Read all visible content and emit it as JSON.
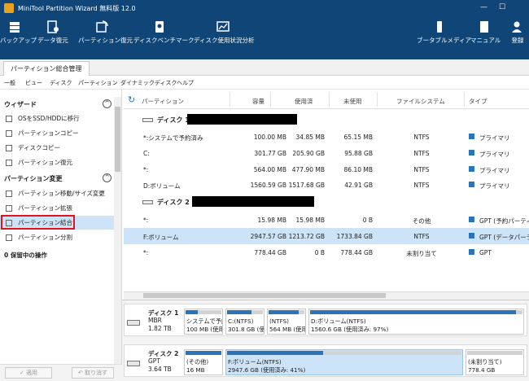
{
  "app": {
    "title": "MiniTool Partition Wizard 無料版 12.0"
  },
  "toolbar": {
    "items": [
      {
        "label": "バックアップ",
        "icon": "backup-icon"
      },
      {
        "label": "データ復元",
        "icon": "data-recovery-icon"
      },
      {
        "label": "パーティション復元",
        "icon": "partition-recovery-icon"
      },
      {
        "label": "ディスクベンチマーク",
        "icon": "disk-benchmark-icon"
      },
      {
        "label": "ディスク使用状況分析",
        "icon": "space-analyzer-icon"
      }
    ],
    "right": [
      {
        "label": "ブータブルメディア",
        "icon": "bootable-media-icon"
      },
      {
        "label": "マニュアル",
        "icon": "manual-icon"
      },
      {
        "label": "登録",
        "icon": "register-icon"
      }
    ]
  },
  "tab": {
    "label": "パーティション総合管理"
  },
  "menu": [
    "一般",
    "ビュー",
    "ディスク",
    "パーティション",
    "ダイナミックディスク",
    "ヘルプ"
  ],
  "sidebar": {
    "wizard": {
      "title": "ウィザード",
      "items": [
        "OSをSSD/HDDに移行",
        "パーティションコピー",
        "ディスクコピー",
        "パーティション復元"
      ]
    },
    "change": {
      "title": "パーティション変更",
      "items": [
        "パーティション移動/サイズ変更",
        "パーティション拡張",
        "パーティション結合",
        "パーティション分割"
      ]
    },
    "pending": "0 保留中の操作",
    "apply": "✓ 適用",
    "undo": "↶ 取り消す"
  },
  "table": {
    "headers": [
      "パーティション",
      "容量",
      "使用済",
      "未使用",
      "ファイルシステム",
      "タイプ"
    ],
    "disk1": {
      "label": "ディスク 1"
    },
    "disk2": {
      "label": "ディスク 2 ("
    },
    "rows1": [
      [
        "*:システムで予約済み",
        "100.00 MB",
        "34.85 MB",
        "65.15 MB",
        "NTFS",
        "プライマリ"
      ],
      [
        "C:",
        "301.77 GB",
        "205.90 GB",
        "95.88 GB",
        "NTFS",
        "プライマリ"
      ],
      [
        "*:",
        "564.00 MB",
        "477.90 MB",
        "86.10 MB",
        "NTFS",
        "プライマリ"
      ],
      [
        "D:ボリューム",
        "1560.59 GB",
        "1517.68 GB",
        "42.91 GB",
        "NTFS",
        "プライマリ"
      ]
    ],
    "rows2": [
      [
        "*:",
        "15.98 MB",
        "15.98 MB",
        "0 B",
        "その他",
        "GPT (予約パーティシ"
      ],
      [
        "F:ボリューム",
        "2947.57 GB",
        "1213.72 GB",
        "1733.84 GB",
        "NTFS",
        "GPT (データパーティ"
      ],
      [
        "*:",
        "778.44 GB",
        "0 B",
        "778.44 GB",
        "未割り当て",
        "GPT"
      ]
    ]
  },
  "map": {
    "disk1": {
      "name": "ディスク 1",
      "style": "MBR",
      "size": "1.82 TB",
      "parts": [
        {
          "l1": "システムで予約",
          "l2": "100 MB (使用",
          "fill": 0.35
        },
        {
          "l1": "C:(NTFS)",
          "l2": "301.8 GB (使用",
          "fill": 0.68
        },
        {
          "l1": "(NTFS)",
          "l2": "564 MB (使用",
          "fill": 0.85
        },
        {
          "l1": "D:ボリューム(NTFS)",
          "l2": "1560.6 GB (使用済み: 97%)",
          "fill": 0.97
        }
      ]
    },
    "disk2": {
      "name": "ディスク 2",
      "style": "GPT",
      "size": "3.64 TB",
      "parts": [
        {
          "l1": "(その他)",
          "l2": "16 MB",
          "fill": 1.0
        },
        {
          "l1": "F:ボリューム(NTFS)",
          "l2": "2947.6 GB (使用済み: 41%)",
          "fill": 0.41
        },
        {
          "l1": "(未割り当て)",
          "l2": "778.4 GB",
          "fill": 0
        }
      ]
    }
  },
  "colors": {
    "brand": "#0f4677",
    "accent": "#2b74b7",
    "selected": "#cde3f7",
    "highlight": "#e0141f"
  }
}
